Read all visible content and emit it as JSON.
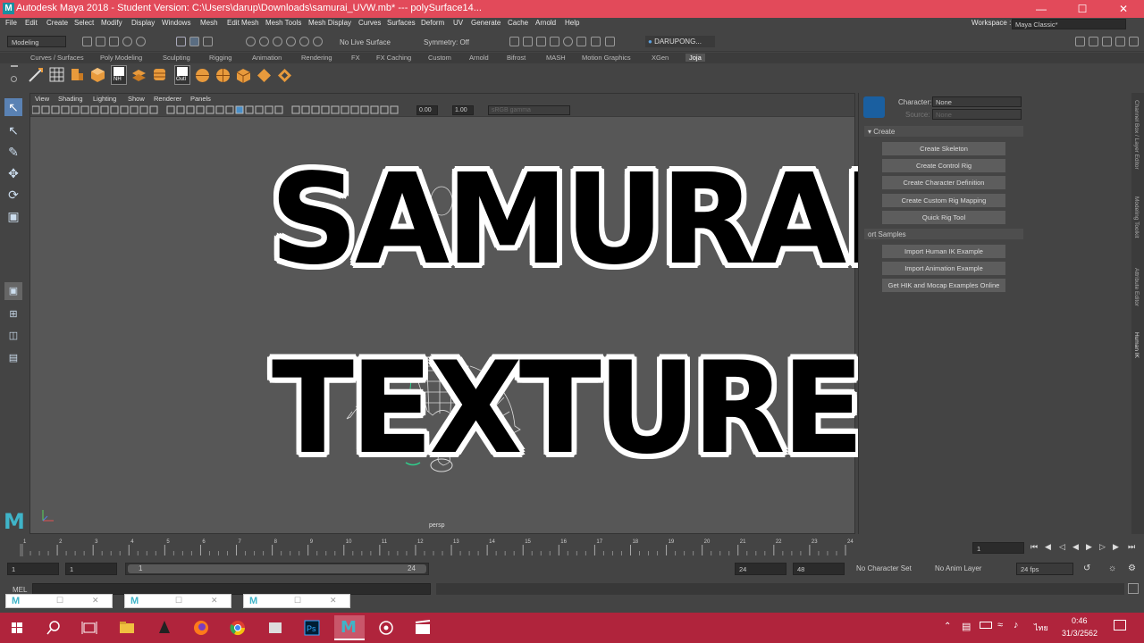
{
  "window": {
    "title": "Autodesk Maya 2018 - Student Version: C:\\Users\\darup\\Downloads\\samurai_UVW.mb*   ---   polySurface14...",
    "min": "—",
    "max": "☐",
    "close": "✕"
  },
  "menu": [
    "File",
    "Edit",
    "Create",
    "Select",
    "Modify",
    "Display",
    "Windows",
    "Mesh",
    "Edit Mesh",
    "Mesh Tools",
    "Mesh Display",
    "Curves",
    "Surfaces",
    "Deform",
    "UV",
    "Generate",
    "Cache",
    "Arnold",
    "Help"
  ],
  "workspace": {
    "label": "Workspace :",
    "value": "Maya Classic*"
  },
  "statusline": {
    "mode": "Modeling",
    "live_surface": "No Live Surface",
    "symmetry": "Symmetry: Off",
    "user": "DARUPONG..."
  },
  "shelf_tabs": [
    "Curves / Surfaces",
    "Poly Modeling",
    "Sculpting",
    "Rigging",
    "Animation",
    "Rendering",
    "FX",
    "FX Caching",
    "Custom",
    "Arnold",
    "Bifrost",
    "MASH",
    "Motion Graphics",
    "XGen",
    "Joja"
  ],
  "shelf_labels": {
    "nh": "NH",
    "outl": "Outl"
  },
  "viewport": {
    "menu": [
      "View",
      "Shading",
      "Lighting",
      "Show",
      "Renderer",
      "Panels"
    ],
    "field1": "0.00",
    "field2": "1.00",
    "colorspace": "sRGB gamma",
    "camera": "persp"
  },
  "overlay": {
    "line1": "SAMURAI",
    "line2": "TEXTURE"
  },
  "hik": {
    "character_label": "Character:",
    "character_value": "None",
    "source_label": "Source:",
    "source_value": "None",
    "section_create": "Create",
    "buttons": [
      "Create Skeleton",
      "Create Control Rig",
      "Create Character Definition",
      "Create Custom Rig Mapping",
      "Quick Rig Tool"
    ],
    "section_samples": "ort Samples",
    "sample_buttons": [
      "Import Human IK Example",
      "Import Animation Example",
      "Get HIK and Mocap Examples Online"
    ]
  },
  "side_tabs": [
    "Channel Box / Layer Editor",
    "Modeling Toolkit",
    "Attribute Editor",
    "Human IK"
  ],
  "timeline": {
    "ticks": [
      "1",
      "2",
      "3",
      "4",
      "5",
      "6",
      "7",
      "8",
      "9",
      "10",
      "11",
      "12",
      "13",
      "14",
      "15",
      "16",
      "17",
      "18",
      "19",
      "20",
      "21",
      "22",
      "23",
      "24"
    ],
    "current": "1"
  },
  "range": {
    "start": "1",
    "inner_start": "1",
    "slider_start": "1",
    "slider_end": "24",
    "end": "24",
    "outer_end": "48",
    "char_set": "No Character Set",
    "anim_layer": "No Anim Layer",
    "fps": "24 fps"
  },
  "cmd": {
    "label": "MEL"
  },
  "taskbar": {
    "time": "0:46",
    "date": "31/3/2562",
    "lang": "ไทย"
  },
  "colors": {
    "titlebar": "#e24a5a",
    "taskbar": "#b0243c",
    "maya_accent": "#3fb4c8"
  }
}
